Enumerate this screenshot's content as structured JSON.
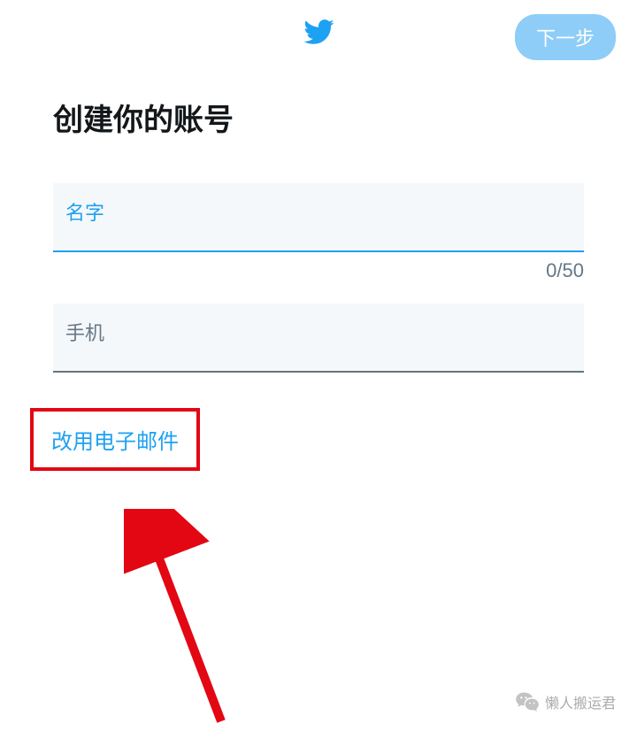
{
  "header": {
    "next_button_label": "下一步"
  },
  "page": {
    "title": "创建你的账号"
  },
  "form": {
    "name_field": {
      "label": "名字",
      "counter": "0/50"
    },
    "phone_field": {
      "label": "手机"
    },
    "switch_link_label": "改用电子邮件"
  },
  "watermark": {
    "text": "懒人搬运君"
  }
}
